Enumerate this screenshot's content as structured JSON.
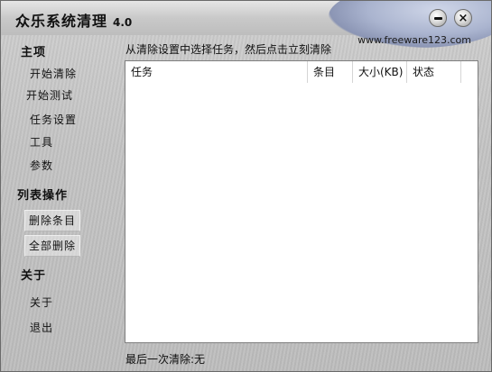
{
  "window": {
    "title": "众乐系统清理",
    "version": "4.0",
    "website": "www.freeware123.com",
    "minimize_icon": "minimize-icon",
    "close_glyph": "×"
  },
  "sidebar": {
    "sections": [
      {
        "title": "主项",
        "items": [
          "开始清除",
          "开始测试",
          "任务设置",
          "工具",
          "参数"
        ]
      },
      {
        "title": "列表操作",
        "items": [
          "删除条目",
          "全部删除"
        ]
      },
      {
        "title": "关于",
        "items": [
          "关于",
          "退出"
        ]
      }
    ]
  },
  "main": {
    "hint": "从清除设置中选择任务，然后点击立刻清除",
    "columns": [
      "任务",
      "条目",
      "大小(KB)",
      "状态"
    ],
    "rows": [],
    "status": "最后一次清除:无"
  },
  "colors": {
    "window_bg": "#c4c4c4",
    "swoosh": "#aab4cf",
    "list_bg": "#ffffff"
  }
}
